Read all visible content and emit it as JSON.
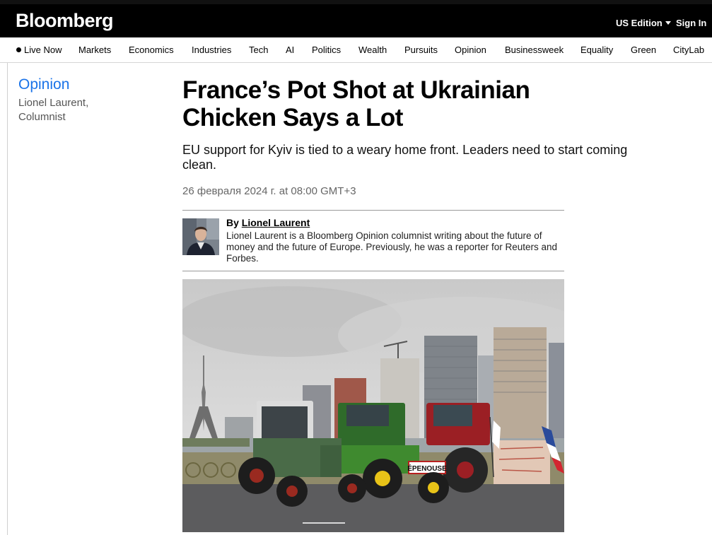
{
  "header": {
    "logo": "Bloomberg",
    "edition_label": "US Edition",
    "signin_label": "Sign In"
  },
  "nav": {
    "items": [
      {
        "label": "Live Now"
      },
      {
        "label": "Markets"
      },
      {
        "label": "Economics"
      },
      {
        "label": "Industries"
      },
      {
        "label": "Tech"
      },
      {
        "label": "AI"
      },
      {
        "label": "Politics"
      },
      {
        "label": "Wealth"
      },
      {
        "label": "Pursuits"
      },
      {
        "label": "Opinion"
      },
      {
        "label": "Businessweek"
      },
      {
        "label": "Equality"
      },
      {
        "label": "Green"
      },
      {
        "label": "CityLab"
      }
    ]
  },
  "sidebar": {
    "section": "Opinion",
    "author_line": "Lionel Laurent, Columnist"
  },
  "article": {
    "headline": "France’s Pot Shot at Ukrainian Chicken Says a Lot",
    "dek": "EU support for Kyiv is tied to a weary home front. Leaders need to start coming clean.",
    "date": "26 февраля 2024 г. at 08:00 GMT+3",
    "byline_prefix": "By",
    "author": "Lionel Laurent",
    "bio": "Lionel Laurent is a Bloomberg Opinion columnist writing about the future of money and the future of Europe. Previously, he was a reporter for Reuters and Forbes.",
    "hero_sign": "ÉPENOUSE"
  },
  "colors": {
    "topbar": "#000000",
    "opinion_link": "#1a73e8",
    "rule": "#9a9a9a"
  }
}
